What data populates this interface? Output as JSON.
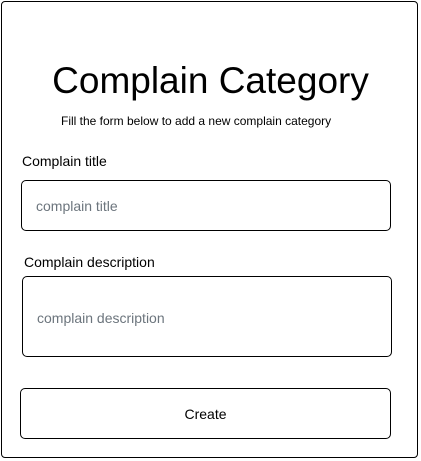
{
  "form": {
    "title": "Complain Category",
    "subtitle": "Fill the form below to add a new complain category",
    "fields": {
      "title": {
        "label": "Complain title",
        "placeholder": "complain title",
        "value": ""
      },
      "description": {
        "label": "Complain description",
        "placeholder": "complain description",
        "value": ""
      }
    },
    "submit_label": "Create"
  },
  "colors": {
    "border": "#000000",
    "background": "#ffffff",
    "placeholder": "#6c757d"
  }
}
